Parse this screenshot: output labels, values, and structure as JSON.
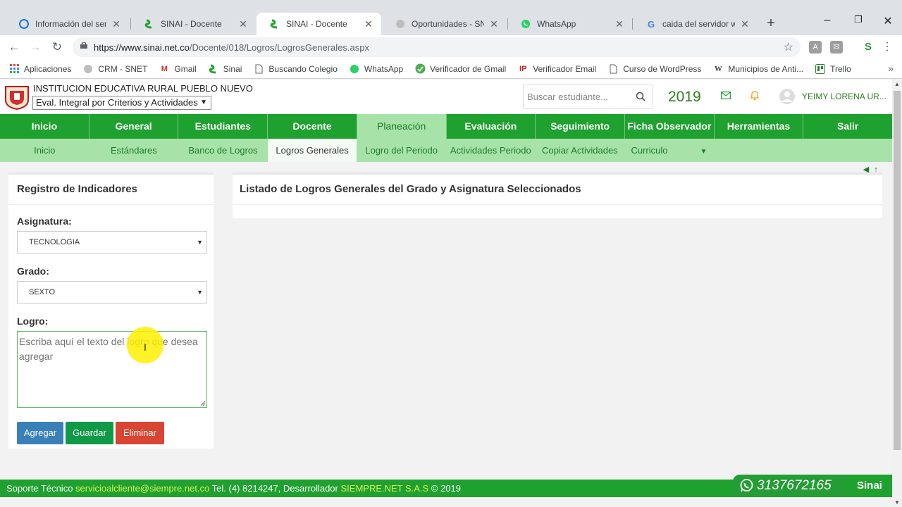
{
  "tabs": [
    {
      "title": "Información del semina",
      "icon": "globe-icon"
    },
    {
      "title": "SINAI - Docente",
      "icon": "sinai-icon"
    },
    {
      "title": "SINAI - Docente",
      "icon": "sinai-icon",
      "active": true
    },
    {
      "title": "Oportunidades - SNET",
      "icon": "snet-icon"
    },
    {
      "title": "WhatsApp",
      "icon": "whatsapp-icon"
    },
    {
      "title": "caida del servidor what",
      "icon": "google-icon"
    }
  ],
  "address": {
    "domain": "https://www.sinai.net.co",
    "path": "/Docente/018/Logros/LogrosGenerales.aspx"
  },
  "bookmarks": [
    {
      "label": "Aplicaciones",
      "icon": "apps-grid-icon"
    },
    {
      "label": "CRM - SNET",
      "icon": "snet-icon"
    },
    {
      "label": "Gmail",
      "icon": "gmail-icon"
    },
    {
      "label": "Sinai",
      "icon": "sinai-icon"
    },
    {
      "label": "Buscando Colegio",
      "icon": "page-icon"
    },
    {
      "label": "WhatsApp",
      "icon": "whatsapp-icon"
    },
    {
      "label": "Verificador de Gmail",
      "icon": "check-icon"
    },
    {
      "label": "Verificador Email",
      "icon": "ip-icon"
    },
    {
      "label": "Curso de WordPress",
      "icon": "page-icon"
    },
    {
      "label": "Municipios de Anti...",
      "icon": "wikipedia-icon"
    },
    {
      "label": "Trello",
      "icon": "trello-icon"
    }
  ],
  "header": {
    "school": "INSTITUCION EDUCATIVA RURAL PUEBLO NUEVO",
    "eval_mode": "Eval. Integral por Criterios y Actividades",
    "search_placeholder": "Buscar estudiante...",
    "year": "2019",
    "user": "YEIMY LORENA UR..."
  },
  "main_nav": [
    "Inicio",
    "General",
    "Estudiantes",
    "Docente",
    "Planeación",
    "Evaluación",
    "Seguimiento",
    "Ficha Observador",
    "Herramientas",
    "Salir"
  ],
  "main_nav_active": 4,
  "sub_nav": [
    "Inicio",
    "Estándares",
    "Banco de Logros",
    "Logros Generales",
    "Logro del Periodo",
    "Actividades Periodo",
    "Copiar Actividades",
    "Curriculo"
  ],
  "sub_nav_active": 3,
  "form": {
    "title": "Registro de Indicadores",
    "asignatura_label": "Asignatura:",
    "asignatura_value": "TECNOLOGIA",
    "grado_label": "Grado:",
    "grado_value": "SEXTO",
    "logro_label": "Logro:",
    "logro_placeholder": "Escriba aquí el texto del logro que desea agregar",
    "btn_agregar": "Agregar",
    "btn_guardar": "Guardar",
    "btn_eliminar": "Eliminar"
  },
  "list": {
    "title": "Listado de Logros Generales del Grado y Asignatura Seleccionados"
  },
  "footer": {
    "prefix": "Soporte Técnico ",
    "email": "servicioalcliente@siempre.net.co",
    "phone": " Tel. (4) 8214247, Desarrollador ",
    "developer": "SIEMPRE.NET S.A.S",
    "copyright": " © 2019"
  },
  "whatsapp_number": "3137672165",
  "sinai_brand": "Sinai",
  "colors": {
    "primary_green": "#1fa12f",
    "light_green": "#a7e3a9",
    "agregar": "#3a80b8",
    "guardar": "#0f9a48",
    "eliminar": "#d84532"
  }
}
